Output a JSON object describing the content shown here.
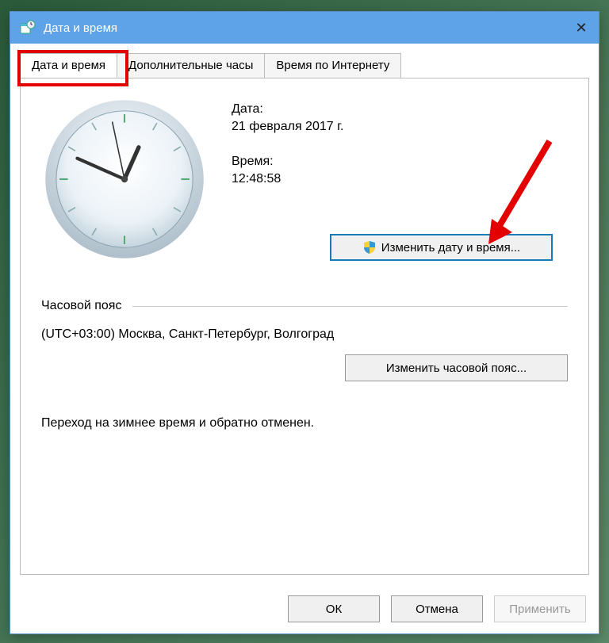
{
  "title": "Дата и время",
  "tabs": [
    {
      "label": "Дата и время",
      "active": true
    },
    {
      "label": "Дополнительные часы",
      "active": false
    },
    {
      "label": "Время по Интернету",
      "active": false
    }
  ],
  "date_label": "Дата:",
  "date_value": "21 февраля 2017 г.",
  "time_label": "Время:",
  "time_value": "12:48:58",
  "change_dt_button": "Изменить дату и время...",
  "timezone_section_label": "Часовой пояс",
  "timezone_value": "(UTC+03:00) Москва, Санкт-Петербург, Волгоград",
  "change_tz_button": "Изменить часовой пояс...",
  "dst_text": "Переход на зимнее время и обратно отменен.",
  "buttons": {
    "ok": "ОК",
    "cancel": "Отмена",
    "apply": "Применить"
  },
  "clock": {
    "hour": 12,
    "minute": 48,
    "second": 58
  }
}
